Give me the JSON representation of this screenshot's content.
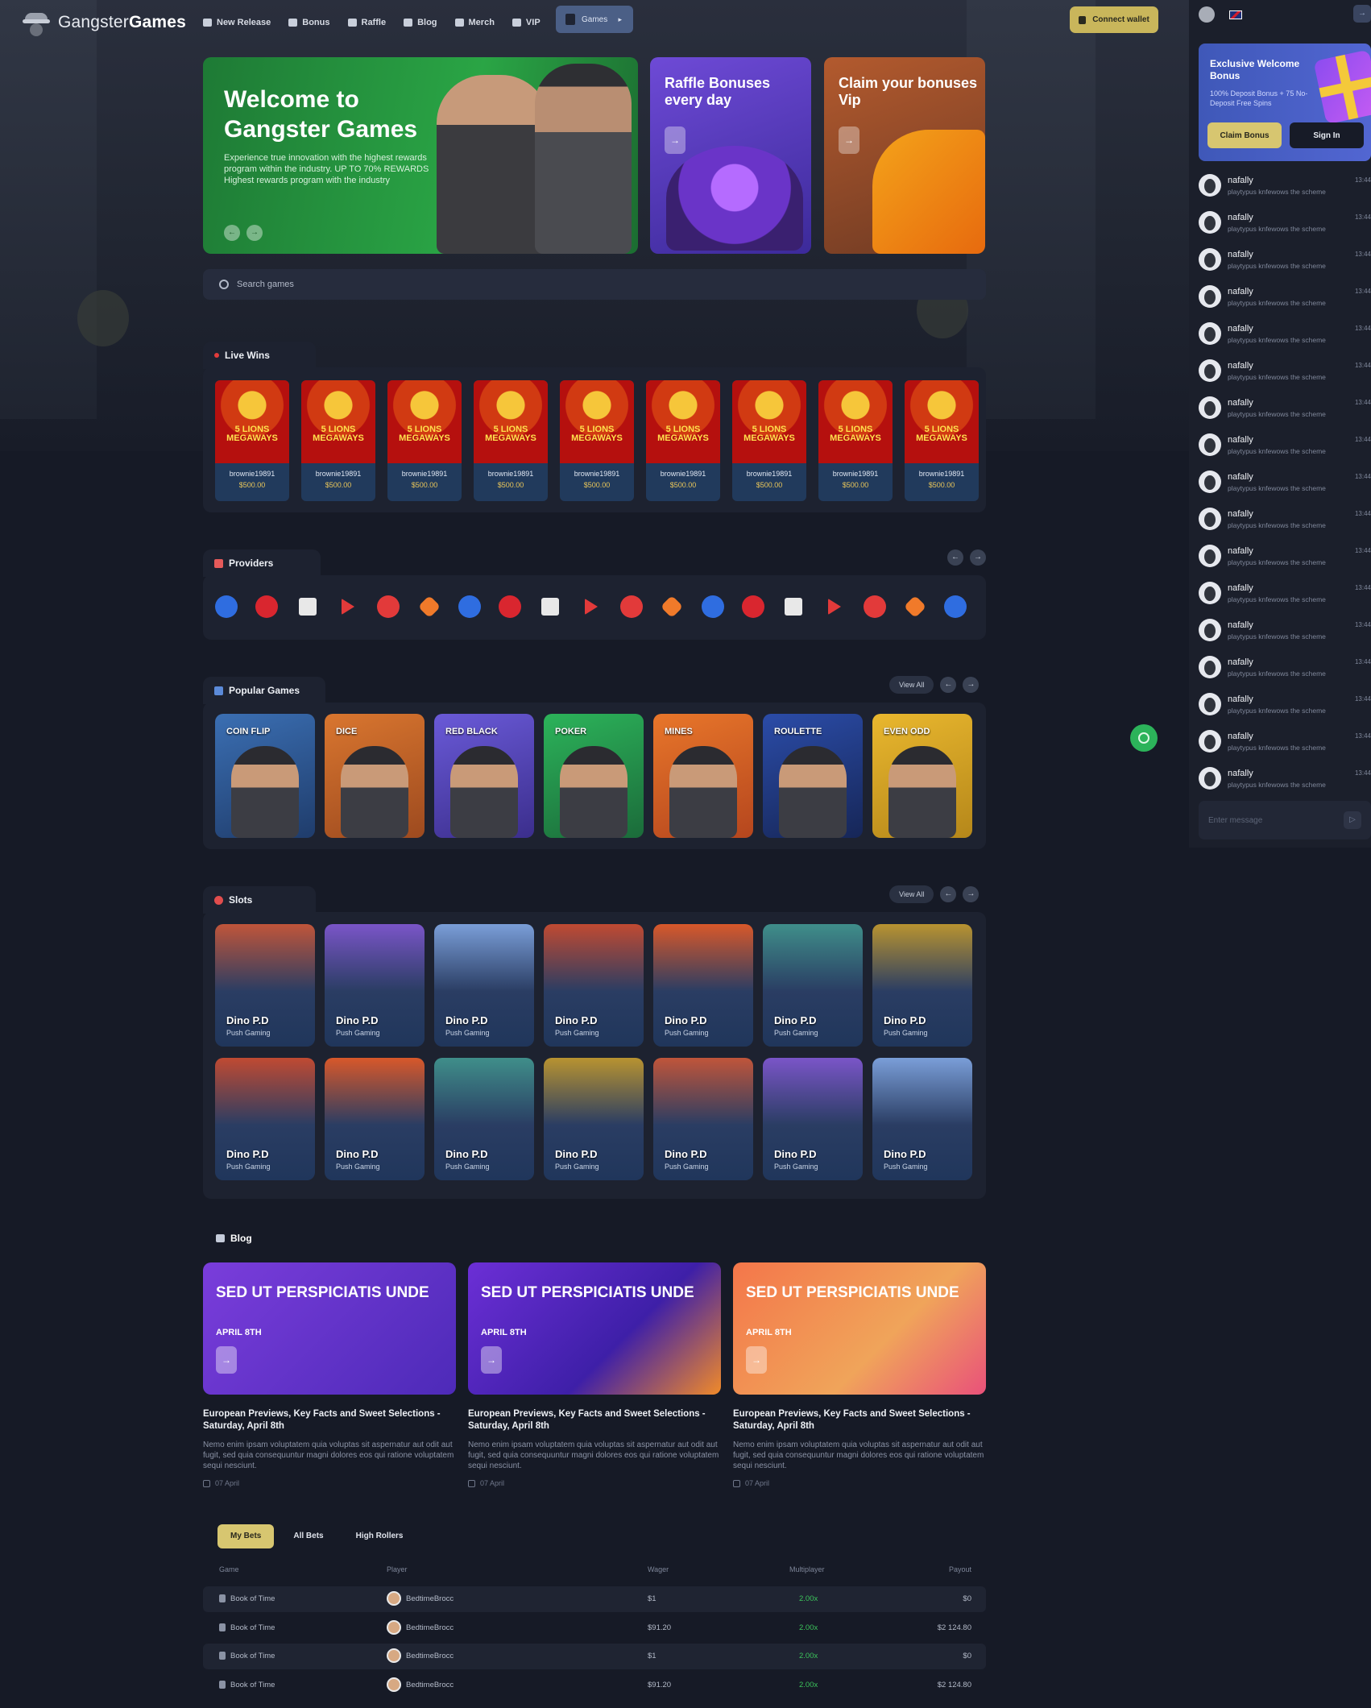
{
  "brand": {
    "name_light": "Gangster",
    "name_bold": "Games"
  },
  "nav": [
    {
      "label": "New Release",
      "icon": "new-release-icon"
    },
    {
      "label": "Bonus",
      "icon": "bonus-icon"
    },
    {
      "label": "Raffle",
      "icon": "raffle-icon"
    },
    {
      "label": "Blog",
      "icon": "blog-icon"
    },
    {
      "label": "Merch",
      "icon": "merch-icon"
    },
    {
      "label": "VIP",
      "icon": "vip-icon"
    }
  ],
  "games_button": "Games",
  "wallet_button": "Connect wallet",
  "hero": {
    "title": "Welcome to Gangster Games",
    "text": "Experience true innovation with the highest rewards program within the industry. UP TO 70% REWARDS Highest rewards program with the industry"
  },
  "promos": [
    {
      "title": "Raffle Bonuses every day"
    },
    {
      "title": "Claim your bonuses Vip"
    }
  ],
  "search": {
    "placeholder": "Search games"
  },
  "sections": {
    "live_wins": "Live Wins",
    "providers": "Providers",
    "popular": "Popular Games",
    "slots": "Slots",
    "blog": "Blog",
    "view_all": "View All"
  },
  "live_wins": [
    {
      "game": "5 LIONS MEGAWAYS",
      "player": "brownie19891",
      "amount": "$500.00"
    },
    {
      "game": "5 LIONS MEGAWAYS",
      "player": "brownie19891",
      "amount": "$500.00"
    },
    {
      "game": "5 LIONS MEGAWAYS",
      "player": "brownie19891",
      "amount": "$500.00"
    },
    {
      "game": "5 LIONS MEGAWAYS",
      "player": "brownie19891",
      "amount": "$500.00"
    },
    {
      "game": "5 LIONS MEGAWAYS",
      "player": "brownie19891",
      "amount": "$500.00"
    },
    {
      "game": "5 LIONS MEGAWAYS",
      "player": "brownie19891",
      "amount": "$500.00"
    },
    {
      "game": "5 LIONS MEGAWAYS",
      "player": "brownie19891",
      "amount": "$500.00"
    },
    {
      "game": "5 LIONS MEGAWAYS",
      "player": "brownie19891",
      "amount": "$500.00"
    },
    {
      "game": "5 LIONS MEGAWAYS",
      "player": "brownie19891",
      "amount": "$500.00"
    }
  ],
  "popular_games": [
    "COIN FLIP",
    "DICE",
    "RED BLACK",
    "POKER",
    "MINES",
    "ROULETTE",
    "EVEN ODD"
  ],
  "slots": [
    {
      "title": "Dino P.D",
      "provider": "Push Gaming"
    },
    {
      "title": "Dino P.D",
      "provider": "Push Gaming"
    },
    {
      "title": "Dino P.D",
      "provider": "Push Gaming"
    },
    {
      "title": "Dino P.D",
      "provider": "Push Gaming"
    },
    {
      "title": "Dino P.D",
      "provider": "Push Gaming"
    },
    {
      "title": "Dino P.D",
      "provider": "Push Gaming"
    },
    {
      "title": "Dino P.D",
      "provider": "Push Gaming"
    },
    {
      "title": "Dino P.D",
      "provider": "Push Gaming"
    },
    {
      "title": "Dino P.D",
      "provider": "Push Gaming"
    },
    {
      "title": "Dino P.D",
      "provider": "Push Gaming"
    },
    {
      "title": "Dino P.D",
      "provider": "Push Gaming"
    },
    {
      "title": "Dino P.D",
      "provider": "Push Gaming"
    },
    {
      "title": "Dino P.D",
      "provider": "Push Gaming"
    },
    {
      "title": "Dino P.D",
      "provider": "Push Gaming"
    }
  ],
  "blog": [
    {
      "banner": "SED UT PERSPICIATIS UNDE",
      "banner_date": "APRIL 8TH",
      "title": "European Previews, Key Facts and Sweet Selections - Saturday, April 8th",
      "desc": "Nemo enim ipsam voluptatem quia voluptas sit aspernatur aut odit aut fugit, sed quia consequuntur magni dolores eos qui ratione voluptatem sequi nesciunt.",
      "date": "07 April"
    },
    {
      "banner": "SED UT PERSPICIATIS UNDE",
      "banner_date": "APRIL 8TH",
      "title": "European Previews, Key Facts and Sweet Selections - Saturday, April 8th",
      "desc": "Nemo enim ipsam voluptatem quia voluptas sit aspernatur aut odit aut fugit, sed quia consequuntur magni dolores eos qui ratione voluptatem sequi nesciunt.",
      "date": "07 April"
    },
    {
      "banner": "SED UT PERSPICIATIS UNDE",
      "banner_date": "APRIL 8TH",
      "title": "European Previews, Key Facts and Sweet Selections - Saturday, April 8th",
      "desc": "Nemo enim ipsam voluptatem quia voluptas sit aspernatur aut odit aut fugit, sed quia consequuntur magni dolores eos qui ratione voluptatem sequi nesciunt.",
      "date": "07 April"
    }
  ],
  "bets": {
    "tabs": [
      "My Bets",
      "All Bets",
      "High Rollers"
    ],
    "headers": [
      "Game",
      "Player",
      "Wager",
      "Multiplayer",
      "Payout"
    ],
    "rows": [
      {
        "game": "Book of Time",
        "player": "BedtimeBrocc",
        "wager": "$1",
        "mult": "2.00x",
        "payout": "$0"
      },
      {
        "game": "Book of Time",
        "player": "BedtimeBrocc",
        "wager": "$91.20",
        "mult": "2.00x",
        "payout": "$2 124.80"
      },
      {
        "game": "Book of Time",
        "player": "BedtimeBrocc",
        "wager": "$1",
        "mult": "2.00x",
        "payout": "$0"
      },
      {
        "game": "Book of Time",
        "player": "BedtimeBrocc",
        "wager": "$91.20",
        "mult": "2.00x",
        "payout": "$2 124.80"
      }
    ]
  },
  "bonus_card": {
    "title": "Exclusive Welcome Bonus",
    "text": "100% Deposit Bonus + 75 No-Deposit Free Spins",
    "claim": "Claim Bonus",
    "signin": "Sign In"
  },
  "chat": {
    "messages": [
      {
        "user": "nafally",
        "text": "playtypus knfewows the scheme",
        "time": "13:44"
      },
      {
        "user": "nafally",
        "text": "playtypus knfewows the scheme",
        "time": "13:44"
      },
      {
        "user": "nafally",
        "text": "playtypus knfewows the scheme",
        "time": "13:44"
      },
      {
        "user": "nafally",
        "text": "playtypus knfewows the scheme",
        "time": "13:44"
      },
      {
        "user": "nafally",
        "text": "playtypus knfewows the scheme",
        "time": "13:44"
      },
      {
        "user": "nafally",
        "text": "playtypus knfewows the scheme",
        "time": "13:44"
      },
      {
        "user": "nafally",
        "text": "playtypus knfewows the scheme",
        "time": "13:44"
      },
      {
        "user": "nafally",
        "text": "playtypus knfewows the scheme",
        "time": "13:44"
      },
      {
        "user": "nafally",
        "text": "playtypus knfewows the scheme",
        "time": "13:44"
      },
      {
        "user": "nafally",
        "text": "playtypus knfewows the scheme",
        "time": "13:44"
      },
      {
        "user": "nafally",
        "text": "playtypus knfewows the scheme",
        "time": "13:44"
      },
      {
        "user": "nafally",
        "text": "playtypus knfewows the scheme",
        "time": "13:44"
      },
      {
        "user": "nafally",
        "text": "playtypus knfewows the scheme",
        "time": "13:44"
      },
      {
        "user": "nafally",
        "text": "playtypus knfewows the scheme",
        "time": "13:44"
      },
      {
        "user": "nafally",
        "text": "playtypus knfewows the scheme",
        "time": "13:44"
      },
      {
        "user": "nafally",
        "text": "playtypus knfewows the scheme",
        "time": "13:44"
      },
      {
        "user": "nafally",
        "text": "playtypus knfewows the scheme",
        "time": "13:44"
      }
    ],
    "input_placeholder": "Enter message"
  }
}
